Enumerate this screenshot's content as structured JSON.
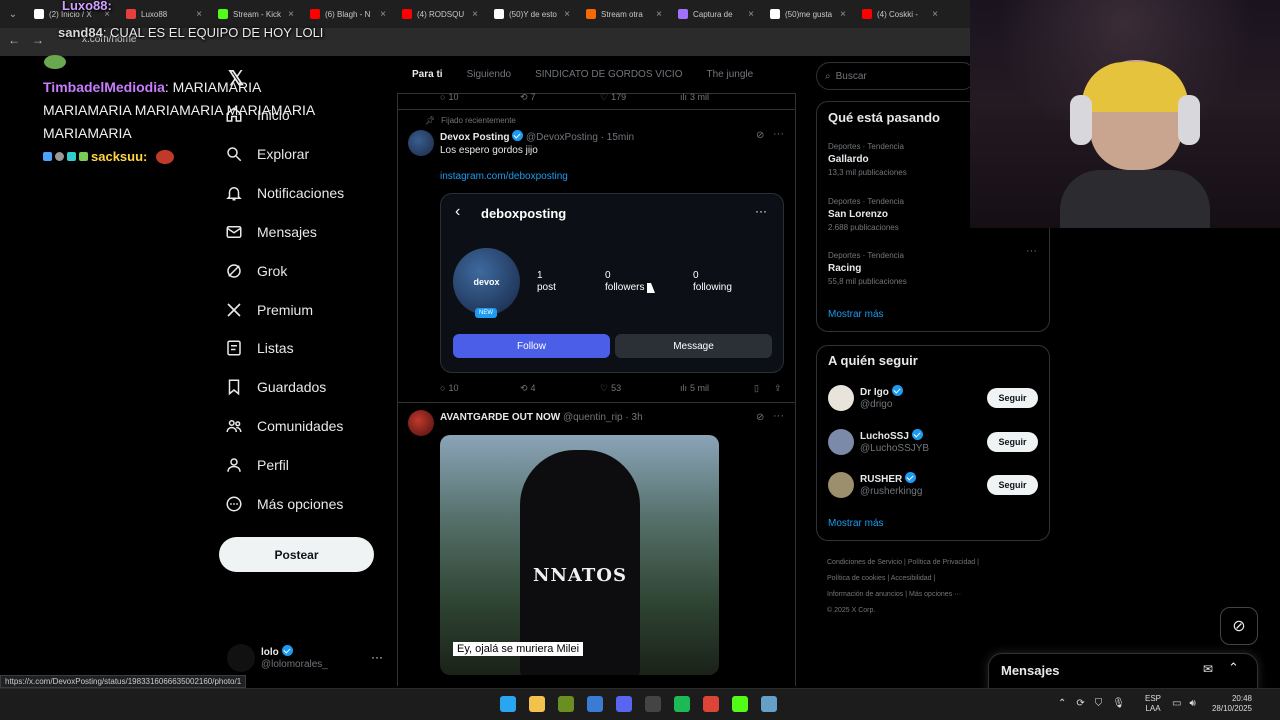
{
  "browser": {
    "tabs": [
      {
        "title": "(2) Inicio / X",
        "color": "#ffffff"
      },
      {
        "title": "Luxo88",
        "color": "#e83e3e"
      },
      {
        "title": "Stream - Kick",
        "color": "#53fc18"
      },
      {
        "title": "(6) Blagh - N",
        "color": "#ff0000"
      },
      {
        "title": "(4) RODSQU",
        "color": "#ff0000"
      },
      {
        "title": "(50)Y de esto",
        "color": "#ffffff"
      },
      {
        "title": "Stream otra",
        "color": "#f56a00"
      },
      {
        "title": "Captura de",
        "color": "#a070ff"
      },
      {
        "title": "(50)me gusta",
        "color": "#ffffff"
      },
      {
        "title": "(4) Coskki -",
        "color": "#ff0000"
      }
    ],
    "url": "x.com/home",
    "status_url": "https://x.com/DevoxPosting/status/1983316066635002160/photo/1"
  },
  "chat": {
    "line1_user": "sand84",
    "line1_text": ": CUAL ES EL EQUIPO DE HOY LOLI",
    "top_user": "Luxo88:",
    "line2_user": "TimbadelMediodia",
    "line2_text": ": MARIAMARIA MARIAMARIA MARIAMARIA MARIAMARIA MARIAMARIA",
    "line3_user": "sacksuu:"
  },
  "nav": {
    "items": [
      {
        "label": "Inicio",
        "icon": "home-icon"
      },
      {
        "label": "Explorar",
        "icon": "search-icon"
      },
      {
        "label": "Notificaciones",
        "icon": "bell-icon"
      },
      {
        "label": "Mensajes",
        "icon": "mail-icon"
      },
      {
        "label": "Grok",
        "icon": "grok-icon"
      },
      {
        "label": "Premium",
        "icon": "x-logo-icon"
      },
      {
        "label": "Listas",
        "icon": "list-icon"
      },
      {
        "label": "Guardados",
        "icon": "bookmark-icon"
      },
      {
        "label": "Comunidades",
        "icon": "people-icon"
      },
      {
        "label": "Perfil",
        "icon": "person-icon"
      },
      {
        "label": "Más opciones",
        "icon": "more-circle-icon"
      }
    ],
    "post_label": "Postear",
    "account_name": "lolo",
    "account_handle": "@lolomorales_"
  },
  "feed": {
    "tabs": [
      "Para ti",
      "Siguiendo",
      "SINDICATO DE GORDOS VICIO",
      "The jungle"
    ],
    "prev_actions": {
      "replies": "10",
      "reposts": "7",
      "likes": "179",
      "views": "3 mil"
    },
    "pinned_label": "Fijado recientemente",
    "post1": {
      "author": "Devox Posting",
      "handle": "@DevoxPosting",
      "time": "15min",
      "text": "Los espero gordos jijo",
      "link": "instagram.com/deboxposting",
      "actions": {
        "replies": "10",
        "reposts": "4",
        "likes": "53",
        "views": "5 mil"
      }
    },
    "ig": {
      "username": "deboxposting",
      "avatar_text": "devox",
      "new_badge": "NEW",
      "posts_n": "1",
      "posts_l": "post",
      "followers_n": "0",
      "followers_l": "followers",
      "following_n": "0",
      "following_l": "following",
      "follow": "Follow",
      "message": "Message"
    },
    "post2": {
      "author": "AVANTGARDE OUT NOW",
      "handle": "@quentin_rip",
      "time": "3h",
      "shirt_text": "NNATOS",
      "caption": "Ey, ojalá se muriera Milei"
    }
  },
  "right": {
    "search_placeholder": "Buscar",
    "trends_title": "Qué está pasando",
    "trends": [
      {
        "meta": "Deportes · Tendencia",
        "name": "Gallardo",
        "count": "13,3 mil publicaciones"
      },
      {
        "meta": "Deportes · Tendencia",
        "name": "San Lorenzo",
        "count": "2.688 publicaciones"
      },
      {
        "meta": "Deportes · Tendencia",
        "name": "Racing",
        "count": "55,8 mil publicaciones"
      }
    ],
    "show_more": "Mostrar más",
    "follow_title": "A quién seguir",
    "follow": [
      {
        "name": "Dr Igo",
        "handle": "@drigo",
        "btn": "Seguir"
      },
      {
        "name": "LuchoSSJ",
        "handle": "@LuchoSSJYB",
        "btn": "Seguir"
      },
      {
        "name": "RUSHER",
        "handle": "@rusherkingg",
        "btn": "Seguir"
      }
    ],
    "footer": [
      "Condiciones de Servicio",
      "Política de Privacidad",
      "Política de cookies",
      "Accesibilidad",
      "Información de anuncios",
      "Más opciones ···",
      "© 2025 X Corp."
    ],
    "messages_title": "Mensajes"
  },
  "taskbar": {
    "lang1": "ESP",
    "lang2": "LAA",
    "time": "20:48",
    "date": "28/10/2025"
  },
  "colors": {
    "accent": "#1d9bf0",
    "ig_button": "#4a5ee8"
  }
}
